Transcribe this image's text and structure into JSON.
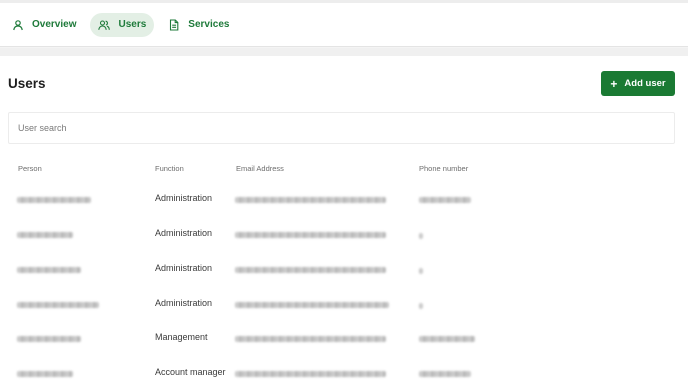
{
  "nav": {
    "tabs": [
      {
        "label": "Overview",
        "icon": "person-icon",
        "active": false
      },
      {
        "label": "Users",
        "icon": "users-icon",
        "active": true
      },
      {
        "label": "Services",
        "icon": "document-icon",
        "active": false
      }
    ]
  },
  "page": {
    "title": "Users",
    "add_button_label": "Add user",
    "search_placeholder": "User search"
  },
  "table": {
    "columns": [
      "Person",
      "Function",
      "Email Address",
      "Phone number"
    ],
    "rows": [
      {
        "function": "Administration"
      },
      {
        "function": "Administration"
      },
      {
        "function": "Administration"
      },
      {
        "function": "Administration"
      },
      {
        "function": "Management"
      },
      {
        "function": "Account manager"
      }
    ]
  },
  "colors": {
    "accent": "#1a7a33",
    "active_tab_bg": "#e3efe5"
  }
}
